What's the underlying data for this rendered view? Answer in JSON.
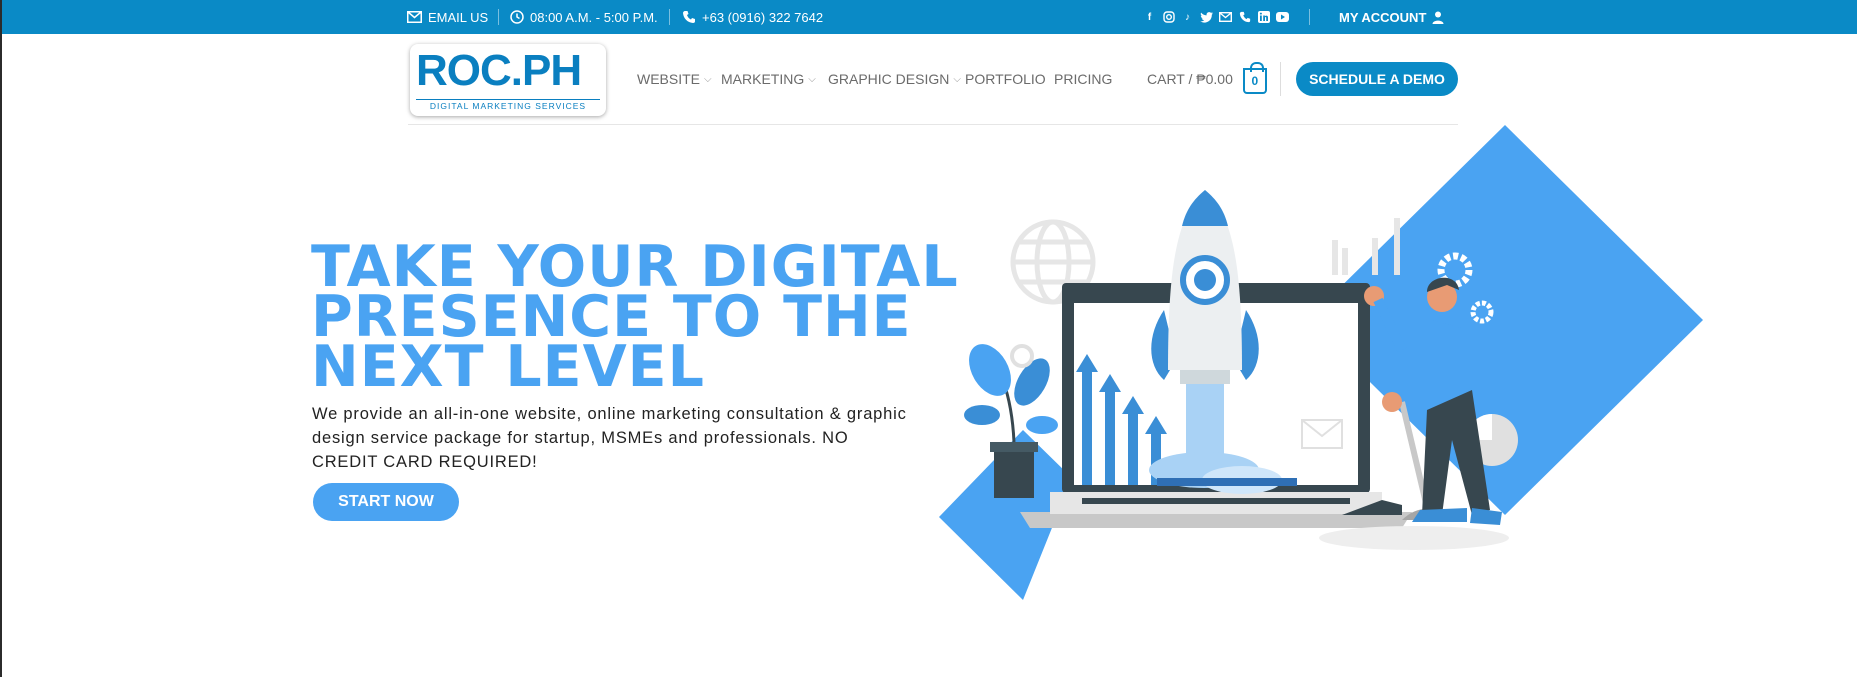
{
  "topbar": {
    "email_label": "EMAIL US",
    "hours": "08:00 A.M. - 5:00 P.M.",
    "phone": "+63 (0916) 322 7642",
    "social_icons": [
      "facebook-icon",
      "instagram-icon",
      "tiktok-icon",
      "twitter-icon",
      "email-icon",
      "phone-icon",
      "linkedin-icon",
      "youtube-icon"
    ],
    "account_label": "MY ACCOUNT"
  },
  "header": {
    "logo_text": "ROC.PH",
    "logo_tagline": "DIGITAL MARKETING SERVICES",
    "nav": [
      {
        "label": "WEBSITE",
        "dropdown": true
      },
      {
        "label": "MARKETING",
        "dropdown": true
      },
      {
        "label": "GRAPHIC DESIGN",
        "dropdown": true
      },
      {
        "label": "PORTFOLIO",
        "dropdown": false
      },
      {
        "label": "PRICING",
        "dropdown": false
      }
    ],
    "cart_label": "CART / ₱0.00",
    "cart_count": "0",
    "cta_label": "SCHEDULE A DEMO"
  },
  "hero": {
    "title_lines": [
      "TAKE YOUR DIGITAL",
      "PRESENCE TO THE",
      "NEXT LEVEL"
    ],
    "description": "We provide an all-in-one website, online marketing consultation & graphic design service package for startup, MSMEs and professionals. NO CREDIT CARD REQUIRED!",
    "button_label": "START NOW"
  },
  "colors": {
    "topbar": "#0a8ac6",
    "accent": "#4aa3f2",
    "cta": "#0a8ac6"
  }
}
